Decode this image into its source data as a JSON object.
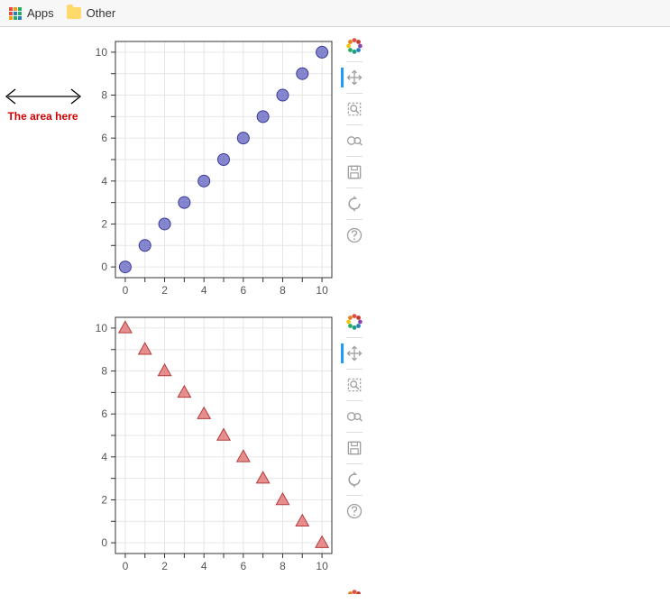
{
  "bookmarks": {
    "apps_label": "Apps",
    "other_label": "Other"
  },
  "annotation": {
    "label": "The area here"
  },
  "toolbar": {
    "tools": [
      "bokeh-logo",
      "pan",
      "box-zoom",
      "wheel-zoom",
      "save",
      "reset",
      "help"
    ],
    "active_tool": "pan"
  },
  "chart_data": [
    {
      "type": "scatter",
      "marker": "circle",
      "color": "#5d5fbf",
      "x": [
        0,
        1,
        2,
        3,
        4,
        5,
        6,
        7,
        8,
        9,
        10
      ],
      "y": [
        0,
        1,
        2,
        3,
        4,
        5,
        6,
        7,
        8,
        9,
        10
      ],
      "xlim": [
        -0.5,
        10.5
      ],
      "ylim": [
        -0.5,
        10.5
      ],
      "xticks": [
        0,
        2,
        4,
        6,
        8,
        10
      ],
      "yticks": [
        0,
        2,
        4,
        6,
        8,
        10
      ]
    },
    {
      "type": "scatter",
      "marker": "triangle",
      "color": "#e06a6a",
      "x": [
        0,
        1,
        2,
        3,
        4,
        5,
        6,
        7,
        8,
        9,
        10
      ],
      "y": [
        10,
        9,
        8,
        7,
        6,
        5,
        4,
        3,
        2,
        1,
        0
      ],
      "xlim": [
        -0.5,
        10.5
      ],
      "ylim": [
        -0.5,
        10.5
      ],
      "xticks": [
        0,
        2,
        4,
        6,
        8,
        10
      ],
      "yticks": [
        0,
        2,
        4,
        6,
        8,
        10
      ]
    }
  ]
}
